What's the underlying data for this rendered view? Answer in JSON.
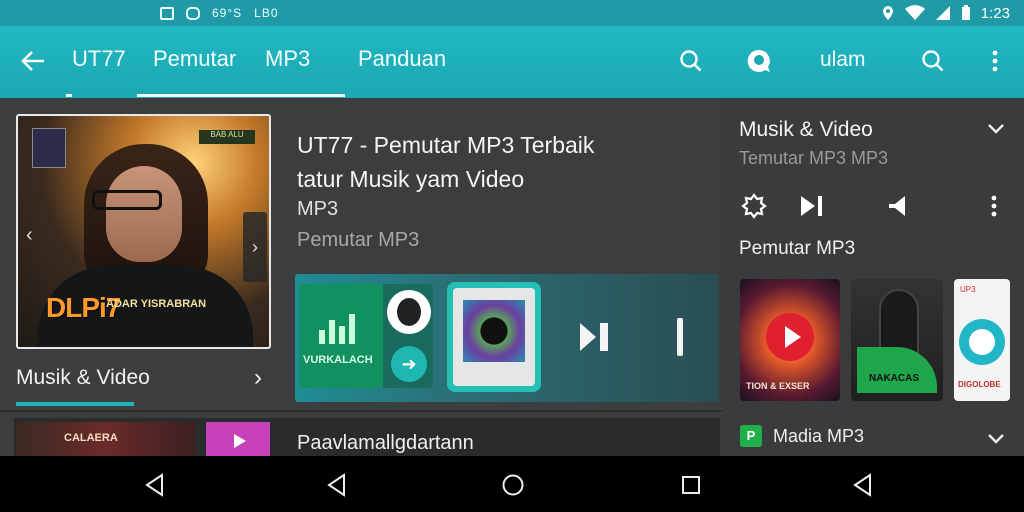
{
  "status_bar": {
    "left_items": [
      "69°S",
      "LB0"
    ],
    "time": "1:23"
  },
  "app_bar": {
    "tabs": [
      "UT77",
      "Pemutar",
      "MP3",
      "Panduan"
    ],
    "right_text": "ulam"
  },
  "main": {
    "title_lines": [
      "UT77 - Pemutar MP3 Terbaik",
      "tatur Musik yam Video"
    ],
    "sub1": "MP3",
    "sub2": "Pemutar MP3",
    "cover_text": "DLPi7",
    "cover_sub": "ADAR YISRABRAN",
    "cover_tag": "BAB ALU",
    "section_link": "Musik & Video",
    "tile_label": "VURKALACH",
    "bottom_thumb_label": "CALAERA",
    "bottom_row_title": "Paavlamallgdartann"
  },
  "right_panel": {
    "title": "Musik & Video",
    "subtitle": "Temutar MP3 MP3",
    "section": "Pemutar MP3",
    "thumb1_label": "TION & EXSER",
    "thumb2_label": "NAKACAS",
    "thumb3_top": "UP3",
    "thumb3_label": "DIGOLOBE",
    "list_item_title": "Madia MP3",
    "list_item_icon": "P"
  },
  "colors": {
    "accent": "#1fb3c0",
    "app_bar": "#22b7c1",
    "background": "#3a3b3d",
    "nav_bar": "#000000"
  }
}
